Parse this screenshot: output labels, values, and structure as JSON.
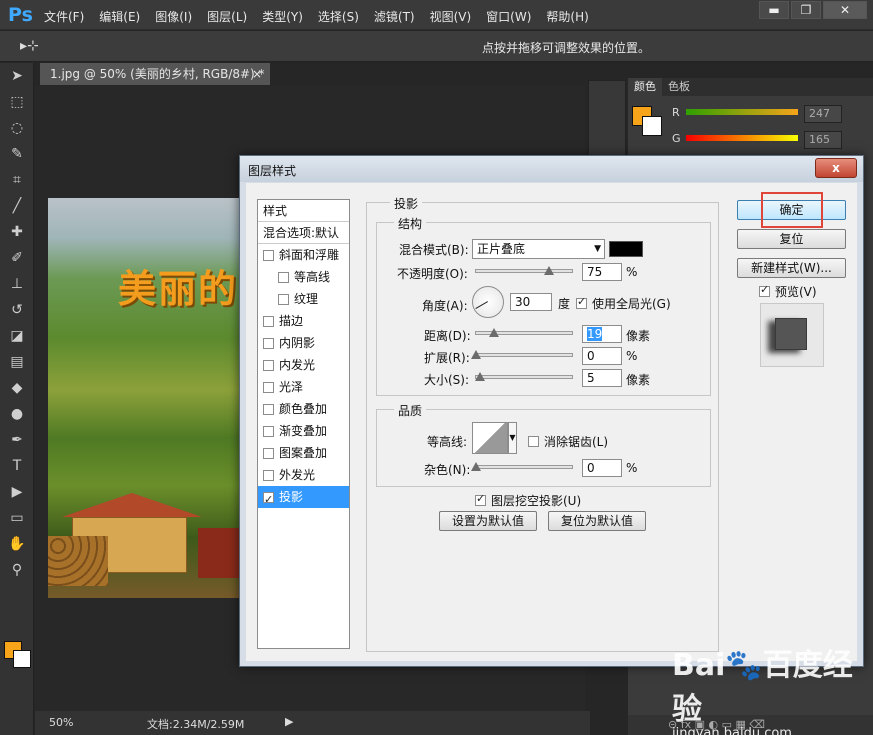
{
  "app": {
    "logo": "Ps"
  },
  "menu": [
    "文件(F)",
    "编辑(E)",
    "图像(I)",
    "图层(L)",
    "类型(Y)",
    "选择(S)",
    "滤镜(T)",
    "视图(V)",
    "窗口(W)",
    "帮助(H)"
  ],
  "window_buttons": {
    "minimize": "▬",
    "restore": "❐",
    "close": "✕"
  },
  "options_bar": {
    "tool_icon": "move-tool-icon",
    "tool_glyph": "▸⊹",
    "hint": "点按并拖移可调整效果的位置。"
  },
  "document": {
    "tab_title": "1.jpg @ 50% (美丽的乡村, RGB/8#) *",
    "close_glyph": "×",
    "image_title_partial": "美丽的"
  },
  "status": {
    "zoom": "50%",
    "doc_size": "文档:2.34M/2.59M",
    "arrow": "▶"
  },
  "right_panel": {
    "tabs": [
      "颜色",
      "色板"
    ],
    "sliders": [
      {
        "label": "R",
        "value": "247"
      },
      {
        "label": "G",
        "value": "165"
      }
    ],
    "fg_color": "#f7a41a",
    "bg_color": "#ffffff",
    "bottom_icons": "⊝ fx ▣ ◐ ▭ ▦ ⌫"
  },
  "dialog": {
    "title": "图层样式",
    "close": "x",
    "style_list": {
      "header": "样式",
      "blend_options": "混合选项:默认",
      "items": [
        {
          "label": "斜面和浮雕",
          "checked": false,
          "indent": false,
          "selected": false
        },
        {
          "label": "等高线",
          "checked": false,
          "indent": true,
          "selected": false
        },
        {
          "label": "纹理",
          "checked": false,
          "indent": true,
          "selected": false
        },
        {
          "label": "描边",
          "checked": false,
          "indent": false,
          "selected": false
        },
        {
          "label": "内阴影",
          "checked": false,
          "indent": false,
          "selected": false
        },
        {
          "label": "内发光",
          "checked": false,
          "indent": false,
          "selected": false
        },
        {
          "label": "光泽",
          "checked": false,
          "indent": false,
          "selected": false
        },
        {
          "label": "颜色叠加",
          "checked": false,
          "indent": false,
          "selected": false
        },
        {
          "label": "渐变叠加",
          "checked": false,
          "indent": false,
          "selected": false
        },
        {
          "label": "图案叠加",
          "checked": false,
          "indent": false,
          "selected": false
        },
        {
          "label": "外发光",
          "checked": false,
          "indent": false,
          "selected": false
        },
        {
          "label": "投影",
          "checked": true,
          "indent": false,
          "selected": true
        }
      ]
    },
    "drop_shadow": {
      "section_title": "投影",
      "structure": {
        "group_title": "结构",
        "blend_mode_label": "混合模式(B):",
        "blend_mode_value": "正片叠底",
        "shadow_color": "#000000",
        "opacity_label": "不透明度(O):",
        "opacity_value": "75",
        "opacity_unit": "%",
        "opacity_level": 0.75,
        "angle_label": "角度(A):",
        "angle_value": "30",
        "angle_unit": "度",
        "global_light_label": "使用全局光(G)",
        "global_light_checked": true,
        "distance_label": "距离(D):",
        "distance_value": "19",
        "distance_unit": "像素",
        "distance_level": 0.19,
        "spread_label": "扩展(R):",
        "spread_value": "0",
        "spread_unit": "%",
        "size_label": "大小(S):",
        "size_value": "5",
        "size_unit": "像素",
        "size_level": 0.05
      },
      "quality": {
        "group_title": "品质",
        "contour_label": "等高线:",
        "antialias_label": "消除锯齿(L)",
        "antialias_checked": false,
        "noise_label": "杂色(N):",
        "noise_value": "0",
        "noise_unit": "%"
      },
      "knockout_label": "图层挖空投影(U)",
      "knockout_checked": true,
      "make_default": "设置为默认值",
      "reset_default": "复位为默认值"
    },
    "buttons": {
      "ok": "确定",
      "reset": "复位",
      "new_style": "新建样式(W)...",
      "preview_label": "预览(V)",
      "preview_checked": true
    }
  },
  "watermark": {
    "logo": "Bai🐾百度经验",
    "url": "jingyan.baidu.com"
  }
}
